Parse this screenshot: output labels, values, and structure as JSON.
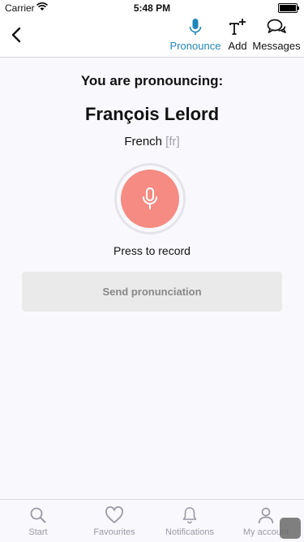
{
  "status_bar": {
    "carrier": "Carrier",
    "time": "5:48 PM"
  },
  "toolbar": {
    "pronounce_label": "Pronounce",
    "add_label": "Add",
    "messages_label": "Messages",
    "accent_color": "#1f86b8"
  },
  "main": {
    "heading": "You are pronouncing:",
    "name": "François Lelord",
    "language": "French",
    "language_code": "[fr]",
    "record_label": "Press to record",
    "record_color": "#f58b82",
    "send_label": "Send pronunciation"
  },
  "tabs": [
    {
      "label": "Start",
      "icon": "search-icon"
    },
    {
      "label": "Favourites",
      "icon": "heart-icon"
    },
    {
      "label": "Notifications",
      "icon": "bell-icon"
    },
    {
      "label": "My account",
      "icon": "user-icon"
    }
  ]
}
